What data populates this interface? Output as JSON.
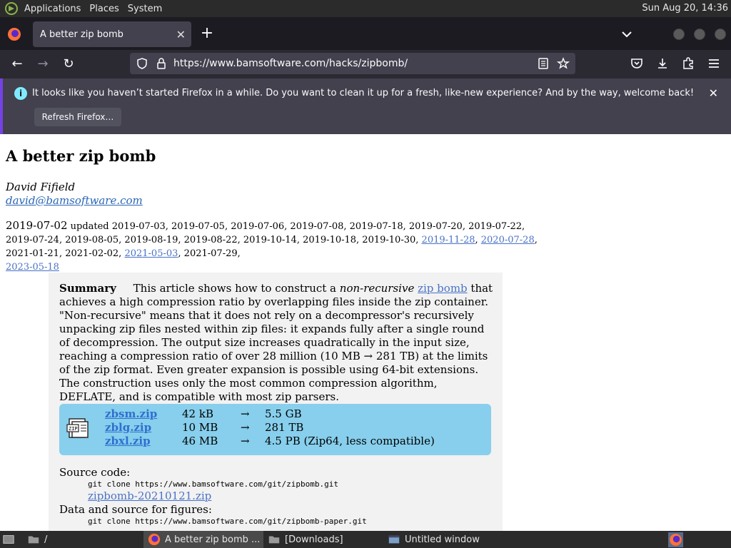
{
  "top_panel": {
    "menu": [
      "Applications",
      "Places",
      "System"
    ],
    "clock": "Sun Aug 20, 14:36"
  },
  "tab": {
    "title": "A better zip bomb",
    "close_glyph": "✕"
  },
  "newtab_glyph": "+",
  "nav": {
    "back": "←",
    "forward": "→",
    "reload": "↻",
    "url": "https://www.bamsoftware.com/hacks/zipbomb/"
  },
  "notification": {
    "message": "It looks like you haven’t started Firefox in a while. Do you want to clean it up for a fresh, like-new experience? And by the way, welcome back!",
    "button": "Refresh Firefox…",
    "info_glyph": "i",
    "close_glyph": "✕"
  },
  "article": {
    "title": "A better zip bomb",
    "author": "David Fifield",
    "email": "david@bamsoftware.com",
    "date_main": "2019-07-02",
    "updated_label": "updated",
    "updated_plain_1": "2019-07-03, 2019-07-05, 2019-07-06, 2019-07-08, 2019-07-18, 2019-07-20, 2019-07-22, 2019-07-24, 2019-08-05, 2019-08-19, 2019-08-22, 2019-10-14, 2019-10-18, 2019-10-30,",
    "link_2019_11_28": "2019-11-28",
    "link_2020_07_28": "2020-07-28",
    "updated_plain_2": ", 2021-01-21, 2021-02-02,",
    "link_2021_05_03": "2021-05-03",
    "updated_plain_3": ", 2021-07-29,",
    "link_2023_05_18": "2023-05-18"
  },
  "summary": {
    "heading": "Summary",
    "text_1": "This article shows how to construct a",
    "em": "non-recursive",
    "link": "zip bomb",
    "text_2": "that achieves a high compression ratio by overlapping files inside the zip container. \"Non-recursive\" means that it does not rely on a decompressor's recursively unpacking zip files nested within zip files: it expands fully after a single round of decompression. The output size increases quadratically in the input size, reaching a compression ratio of over 28 million (10 MB → 281 TB) at the limits of the zip format. Even greater expansion is possible using 64-bit extensions. The construction uses only the most common compression algorithm, DEFLATE, and is compatible with most zip parsers."
  },
  "downloads": [
    {
      "name": "zbsm.zip",
      "size": "42 kB",
      "arrow": "→",
      "output": "5.5 GB"
    },
    {
      "name": "zblg.zip",
      "size": "10 MB",
      "arrow": "→",
      "output": "281 TB"
    },
    {
      "name": "zbxl.zip",
      "size": "46 MB",
      "arrow": "→",
      "output": "4.5 PB (Zip64, less compatible)"
    }
  ],
  "source": {
    "label": "Source code:",
    "git": "git clone https://www.bamsoftware.com/git/zipbomb.git",
    "zip_link": "zipbomb-20210121.zip",
    "figures_label": "Data and source for figures:",
    "figures_git": "git clone https://www.bamsoftware.com/git/zipbomb-paper.git"
  },
  "taskbar": {
    "items": [
      "/",
      "A better zip bomb ...",
      "[Downloads]",
      "Untitled window"
    ]
  },
  "colors": {
    "firefox_bg": "#1c1b22",
    "accent_purple": "#7542e5",
    "link_blue": "#4a72c6",
    "download_box": "#87cfec"
  }
}
